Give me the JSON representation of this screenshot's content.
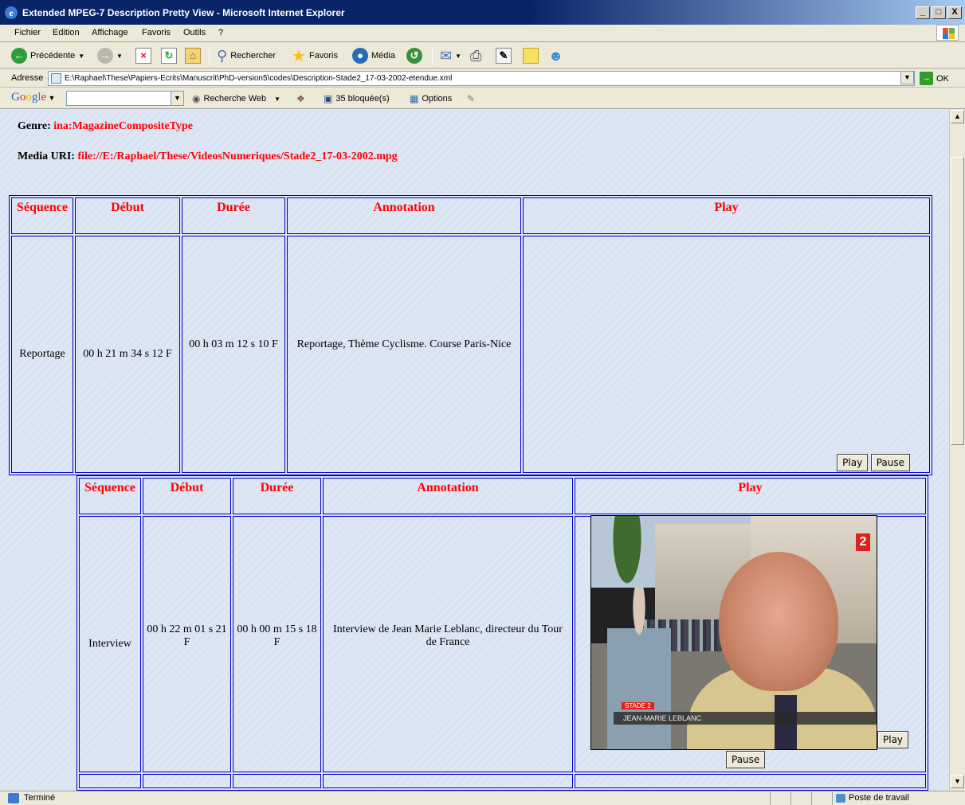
{
  "window": {
    "title": "Extended MPEG-7 Description Pretty View - Microsoft Internet Explorer",
    "controls": [
      "_",
      "□",
      "X"
    ]
  },
  "menu": [
    "Fichier",
    "Edition",
    "Affichage",
    "Favoris",
    "Outils",
    "?"
  ],
  "toolbar": {
    "back": "Précédente",
    "search": "Rechercher",
    "favorites": "Favoris",
    "media": "Média"
  },
  "address": {
    "label": "Adresse",
    "url": "E:\\Raphael\\These\\Papiers-Ecrits\\Manuscrit\\PhD-version5\\codes\\Description-Stade2_17-03-2002-etendue.xml",
    "go": "OK"
  },
  "googlebar": {
    "logo": "Google",
    "web_search": "Recherche Web",
    "blocked": "35 bloquée(s)",
    "options": "Options"
  },
  "page": {
    "genre_label": "Genre:",
    "genre_value": "ina:MagazineCompositeType",
    "media_label": "Media URI:",
    "media_value": "file://E:/Raphael/These/VideosNumeriques/Stade2_17-03-2002.mpg",
    "headers": {
      "sequence": "Séquence",
      "debut": "Début",
      "duree": "Durée",
      "annotation": "Annotation",
      "play": "Play"
    },
    "row1": {
      "sequence": "Reportage",
      "debut": "00 h 21 m 34 s 12 F",
      "duree": "00 h 03 m 12 s 10 F",
      "annotation": "Reportage, Thème Cyclisme. Course Paris-Nice",
      "play_btn": "Play",
      "pause_btn": "Pause"
    },
    "row2": {
      "sequence": "Interview",
      "debut": "00 h 22 m 01 s 21 F",
      "duree": "00 h 00 m 15 s 18 F",
      "annotation": "Interview de Jean Marie Leblanc, directeur du Tour de France",
      "play_btn": "Play",
      "pause_btn": "Pause",
      "video_channel": "2",
      "video_tag": "STADE 2",
      "video_caption": "JEAN-MARIE LEBLANC"
    }
  },
  "status": {
    "text": "Terminé",
    "zone": "Poste de travail"
  }
}
